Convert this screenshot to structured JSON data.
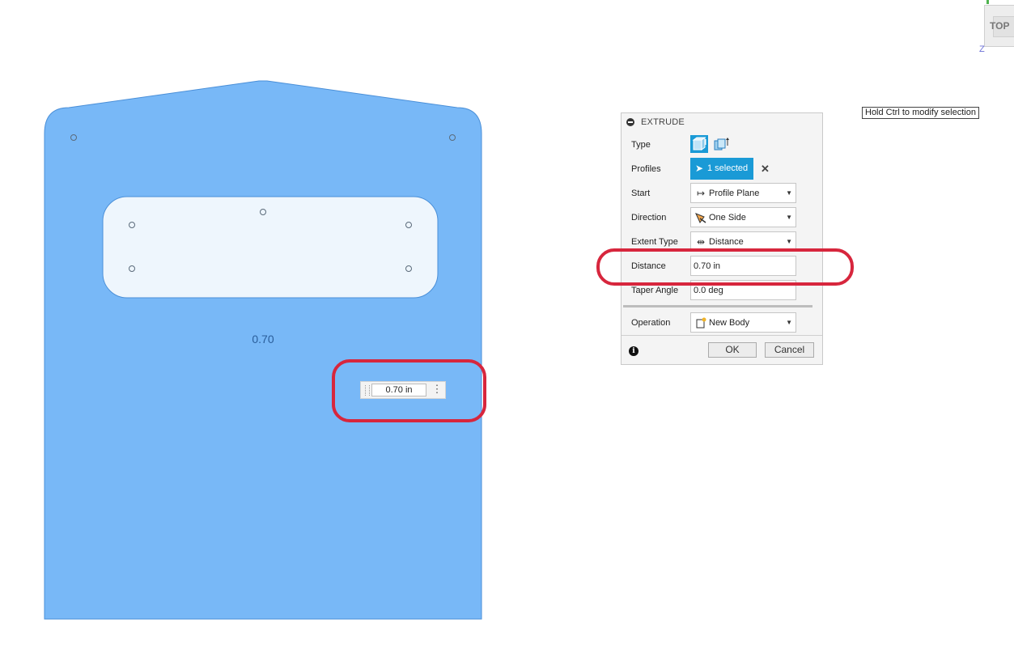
{
  "canvas": {
    "dimension_label": "0.70",
    "inline_distance_value": "0.70 in",
    "inline_menu_icon": "vertical-ellipsis-icon",
    "body_color": "#78b8f7",
    "cutout_color": "#eef6fd",
    "highlight_color": "#d7263d"
  },
  "extrude_panel": {
    "title": "EXTRUDE",
    "rows": {
      "type": {
        "label": "Type",
        "options": [
          "extrude-solid-icon",
          "extrude-thin-icon"
        ],
        "selected": 0
      },
      "profiles": {
        "label": "Profiles",
        "selection": "1 selected"
      },
      "start": {
        "label": "Start",
        "value": "Profile Plane",
        "icon": "profile-plane-icon"
      },
      "direction": {
        "label": "Direction",
        "value": "One Side",
        "icon": "one-side-icon"
      },
      "extent_type": {
        "label": "Extent Type",
        "value": "Distance",
        "icon": "distance-icon"
      },
      "distance": {
        "label": "Distance",
        "value": "0.70 in"
      },
      "taper_angle": {
        "label": "Taper Angle",
        "value": "0.0 deg"
      },
      "operation": {
        "label": "Operation",
        "value": "New Body",
        "icon": "new-body-icon"
      }
    },
    "ok_label": "OK",
    "cancel_label": "Cancel",
    "accent": "#1a9ad6"
  },
  "tooltip": "Hold Ctrl to modify selection",
  "viewcube": {
    "face_label": "TOP",
    "axis_label": "Z"
  }
}
